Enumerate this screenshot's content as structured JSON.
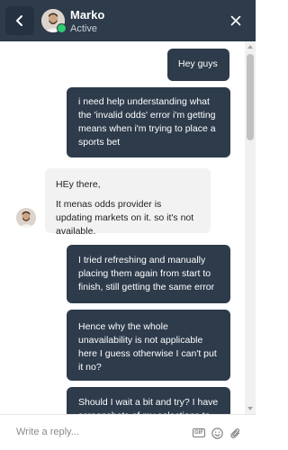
{
  "header": {
    "name": "Marko",
    "status": "Active"
  },
  "messages": [
    {
      "sender": "user",
      "text": "Hey guys"
    },
    {
      "sender": "user",
      "text": "i need help understanding what the 'invalid odds' error i'm getting means when i'm trying to place a sports bet"
    },
    {
      "sender": "agent",
      "line1": "HEy there,",
      "line2": "It menas odds provider is updating markets on it. so it's not available."
    },
    {
      "sender": "user",
      "text": "I tried refreshing and manually placing them again from start to finish, still getting the same error"
    },
    {
      "sender": "user",
      "text": "Hence why the whole unavailability is not applicable here I guess otherwise I can't put it no?"
    },
    {
      "sender": "user",
      "text": "Should I wait a bit and try? I have screenshots of my selections to"
    }
  ],
  "composer": {
    "placeholder": "Write a reply...",
    "gif_label": "GIF"
  },
  "colors": {
    "header_bg": "#2d3b4b",
    "user_bubble_bg": "#2d3b4b",
    "agent_bubble_bg": "#f2f2f2",
    "online": "#2ecc71"
  },
  "icons": {
    "back": "back-arrow-icon",
    "close": "close-icon",
    "gif": "gif-icon",
    "emoji": "emoji-icon",
    "attach": "paperclip-icon"
  }
}
